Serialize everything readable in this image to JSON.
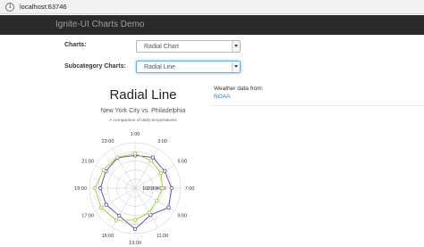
{
  "browser": {
    "url": "localhost:63746"
  },
  "navbar": {
    "brand": "Ignite-UI Charts Demo"
  },
  "form": {
    "charts_label": "Charts:",
    "charts_value": "Radial Chart",
    "subcategory_label": "Subcategory Charts:",
    "subcategory_value": "Radial Line"
  },
  "weather": {
    "label": "Weather data from:",
    "link": "NOAA"
  },
  "colors": {
    "navbar": "#2a2a2a",
    "series_a": "#5b3fa8",
    "series_b": "#9acd32",
    "link": "#337ab7"
  },
  "chart_data": {
    "type": "line",
    "title": "Radial Line",
    "subtitle": "New York City vs. Philadelphia",
    "caption": "A comparison of daily temperatures",
    "angle_labels": [
      "1:00",
      "3:00",
      "5:00",
      "7:00",
      "9:00",
      "11:00",
      "13:00",
      "15:00",
      "17:00",
      "19:00",
      "21:00",
      "23:00"
    ],
    "radial_labels": [
      "10",
      "20",
      "30",
      "40",
      "50"
    ],
    "series": [
      {
        "values": [
          72,
          78,
          75,
          80,
          85,
          68,
          90,
          70,
          73,
          76,
          74,
          77
        ]
      },
      {
        "values": [
          76,
          70,
          66,
          60,
          55,
          62,
          70,
          82,
          86,
          88,
          80,
          78
        ]
      }
    ]
  }
}
